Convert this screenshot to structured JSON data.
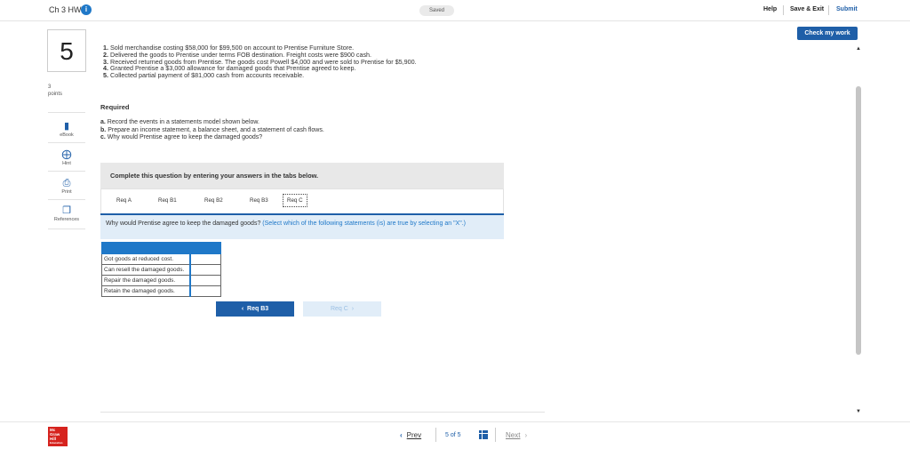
{
  "header": {
    "assignment_title": "Ch 3 HW",
    "info_glyph": "i",
    "saved_status": "Saved",
    "help": "Help",
    "save_exit": "Save & Exit",
    "submit": "Submit",
    "check_my_work": "Check my work"
  },
  "sidebar": {
    "question_number": "5",
    "points_value": "3",
    "points_label": "points",
    "tools": [
      {
        "label": "eBook",
        "icon": "book-icon"
      },
      {
        "label": "Hint",
        "icon": "hint-icon"
      },
      {
        "label": "Print",
        "icon": "print-icon"
      },
      {
        "label": "References",
        "icon": "references-icon"
      }
    ]
  },
  "question": {
    "steps": [
      {
        "n": "1.",
        "text": "Sold merchandise costing $58,000 for $99,500 on account to Prentise Furniture Store."
      },
      {
        "n": "2.",
        "text": "Delivered the goods to Prentise under terms FOB destination. Freight costs were $900 cash."
      },
      {
        "n": "3.",
        "text": "Received returned goods from Prentise. The goods cost Powell $4,000 and were sold to Prentise for $5,900."
      },
      {
        "n": "4.",
        "text": "Granted Prentise a $3,000 allowance for damaged goods that Prentise agreed to keep."
      },
      {
        "n": "5.",
        "text": "Collected partial payment of $81,000 cash from accounts receivable."
      }
    ],
    "required_heading": "Required",
    "requirements": [
      {
        "n": "a.",
        "text": "Record the events in a statements model shown below."
      },
      {
        "n": "b.",
        "text": "Prepare an income statement, a balance sheet, and a statement of cash flows."
      },
      {
        "n": "c.",
        "text": "Why would Prentise agree to keep the damaged goods?"
      }
    ],
    "instruction": "Complete this question by entering your answers in the tabs below."
  },
  "tabs": [
    {
      "label": "Req A",
      "active": false
    },
    {
      "label": "Req B1",
      "active": false
    },
    {
      "label": "Req B2",
      "active": false
    },
    {
      "label": "Req B3",
      "active": false
    },
    {
      "label": "Req C",
      "active": true
    }
  ],
  "prompt": {
    "question": "Why would Prentise agree to keep the damaged goods?",
    "hint": "(Select which of the following statements (is) are true by selecting an \"X\".)"
  },
  "answers": [
    {
      "statement": "Got goods at reduced cost.",
      "mark": ""
    },
    {
      "statement": "Can resell the damaged goods.",
      "mark": ""
    },
    {
      "statement": "Repair the damaged goods.",
      "mark": ""
    },
    {
      "statement": "Retain the damaged goods.",
      "mark": ""
    }
  ],
  "nav": {
    "prev_label": "Req B3",
    "next_label": "Req C"
  },
  "footer": {
    "logo_lines": [
      "Mc",
      "Graw",
      "Hill",
      "Education"
    ],
    "prev": "Prev",
    "page_current": "5",
    "page_of": "of",
    "page_total": "5",
    "next": "Next"
  },
  "colors": {
    "accent": "#1f5fa8",
    "table_header": "#1f78c8",
    "prompt_bg": "#e1edf8",
    "logo": "#d6231e"
  }
}
